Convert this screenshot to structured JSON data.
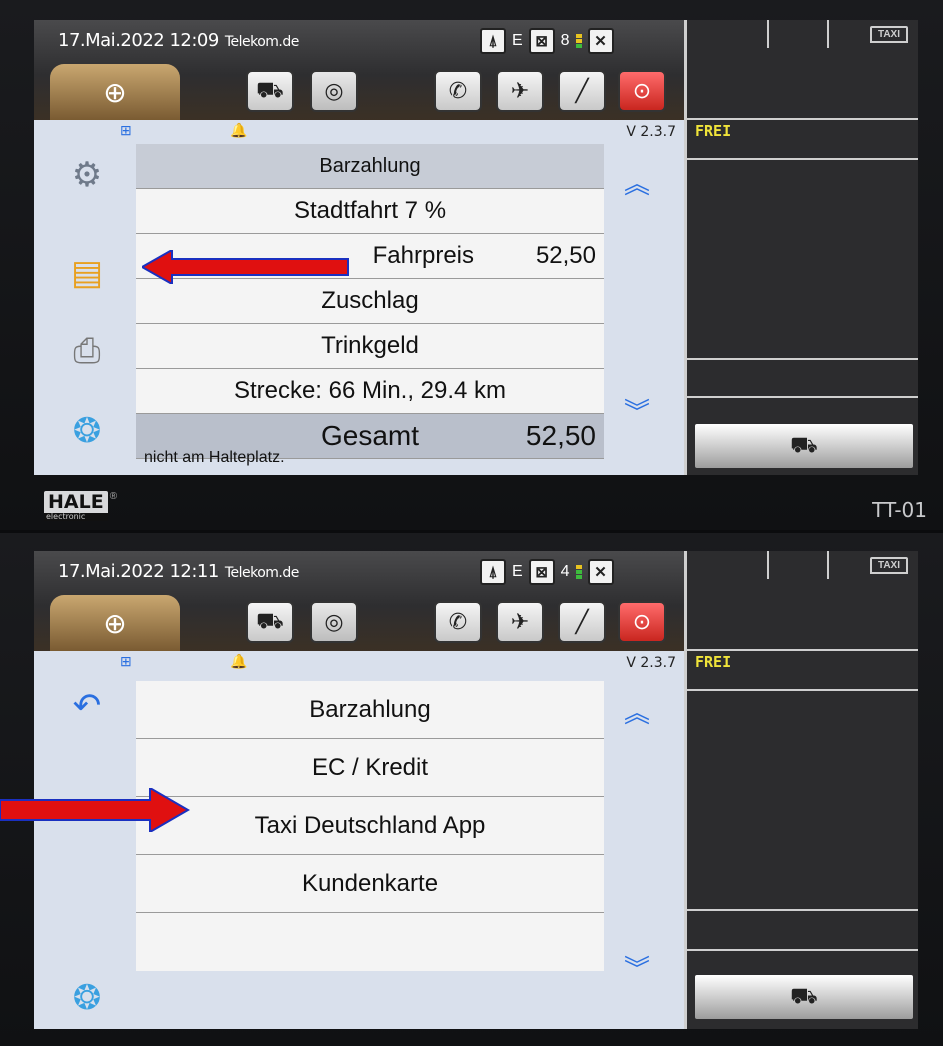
{
  "top": {
    "status": {
      "datetime": "17.Mai.2022 12:09",
      "carrier": "Telekom.de",
      "network": "E",
      "signal": "8"
    },
    "version": "V 2.3.7",
    "list": {
      "header": "Barzahlung",
      "rows": [
        {
          "label": "Stadtfahrt  7 %",
          "amount": ""
        },
        {
          "label": "Fahrpreis",
          "amount": "52,50"
        },
        {
          "label": "Zuschlag",
          "amount": ""
        },
        {
          "label": "Trinkgeld",
          "amount": ""
        },
        {
          "label": "Strecke: 66 Min., 29.4 km",
          "amount": ""
        }
      ],
      "total_label": "Gesamt",
      "total_amount": "52,50"
    },
    "footnote": "nicht am Halteplatz.",
    "panel": {
      "badge": "TAXI",
      "state": "FREI"
    },
    "brand": {
      "logo": "HALE",
      "sub": "electronic",
      "model": "TT-01"
    }
  },
  "bottom": {
    "status": {
      "datetime": "17.Mai.2022 12:11",
      "carrier": "Telekom.de",
      "network": "E",
      "signal": "4"
    },
    "version": "V 2.3.7",
    "options": [
      {
        "label": "Barzahlung"
      },
      {
        "label": "EC / Kredit"
      },
      {
        "label": "Taxi Deutschland App"
      },
      {
        "label": "Kundenkarte"
      },
      {
        "label": ""
      }
    ],
    "panel": {
      "badge": "TAXI",
      "state": "FREI"
    }
  },
  "icons": {
    "home": "logo-icon",
    "car": "car-icon",
    "clock": "clock-icon",
    "phone": "phone-icon",
    "gps": "satellite-icon",
    "tool": "wrench-icon",
    "lock": "lock-icon",
    "settings": "gear-icon",
    "payment": "credit-card-icon",
    "print": "printer-icon",
    "menu": "colors-icon",
    "back": "back-arrow-icon",
    "up": "chevron-up-icon",
    "down": "chevron-down-icon"
  },
  "colors": {
    "accent": "#2a6fe0",
    "frei": "#f0e43a",
    "arrow": "#e01010",
    "screen": "#d9e0ec"
  }
}
